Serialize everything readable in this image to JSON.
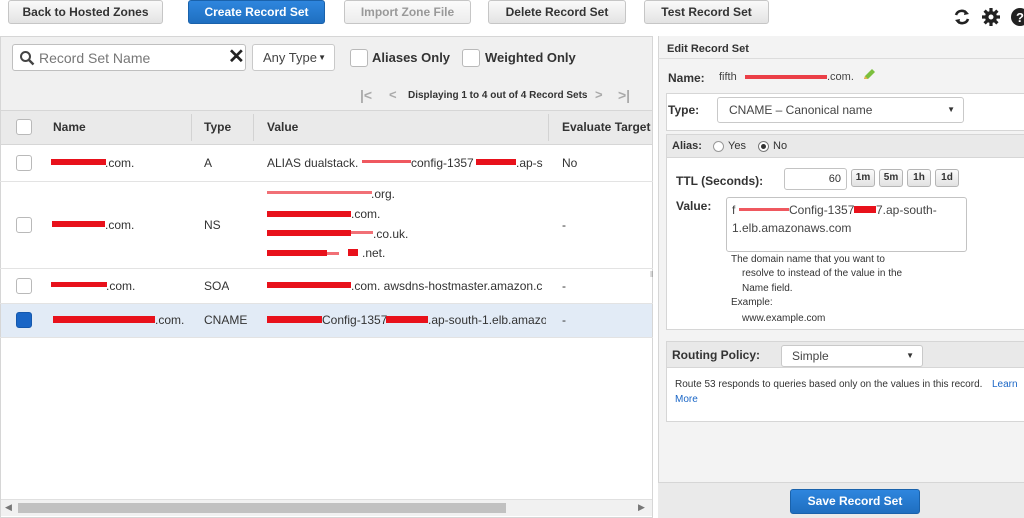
{
  "toolbar": {
    "back": "Back to Hosted Zones",
    "create": "Create Record Set",
    "import": "Import Zone File",
    "delete": "Delete Record Set",
    "test": "Test Record Set"
  },
  "filters": {
    "search_placeholder": "Record Set Name",
    "type": "Any Type",
    "aliases_only": "Aliases Only",
    "weighted_only": "Weighted Only"
  },
  "pagination": {
    "text": "Displaying 1 to 4 out of 4 Record Sets"
  },
  "table": {
    "headers": {
      "name": "Name",
      "type": "Type",
      "value": "Value",
      "eval": "Evaluate Target"
    },
    "rows": [
      {
        "name_suffix": ".com.",
        "type": "A",
        "value_a": "ALIAS dualstack.",
        "value_b": "config-1357",
        "value_c": ".ap-s",
        "eval": "No"
      },
      {
        "name_suffix": ".com.",
        "type": "NS",
        "v1": ".org.",
        "v2": ".com.",
        "v3": ".co.uk.",
        "v4": ".net.",
        "eval": "-"
      },
      {
        "name_suffix": ".com.",
        "type": "SOA",
        "value_b": ".com. awsdns-hostmaster.amazon.c",
        "eval": "-"
      },
      {
        "name_suffix": ".com.",
        "type": "CNAME",
        "value_b": "Config-1357",
        "value_c": ".ap-south-1.elb.amazo",
        "eval": "-"
      }
    ]
  },
  "panel": {
    "title": "Edit Record Set",
    "name_label": "Name:",
    "name_prefix": "fifth",
    "name_suffix": ".com.",
    "type_label": "Type:",
    "type_value": "CNAME – Canonical name",
    "alias_label": "Alias:",
    "alias_yes": "Yes",
    "alias_no": "No",
    "ttl_label": "TTL (Seconds):",
    "ttl_value": "60",
    "ttl_buttons": [
      "1m",
      "5m",
      "1h",
      "1d"
    ],
    "value_label": "Value:",
    "value_line1_a": "f",
    "value_line1_b": "Config-1357",
    "value_line1_c": "7.ap-south-",
    "value_line2": "1.elb.amazonaws.com",
    "help_1": "The domain name that you want to",
    "help_2": "resolve to instead of the value in the",
    "help_3": "Name field.",
    "help_4": "Example:",
    "help_5": "www.example.com",
    "routing_label": "Routing Policy:",
    "routing_value": "Simple",
    "routing_desc": "Route 53 responds to queries based only on the values in this record.",
    "learn": "Learn",
    "more": "More",
    "save": "Save Record Set"
  }
}
